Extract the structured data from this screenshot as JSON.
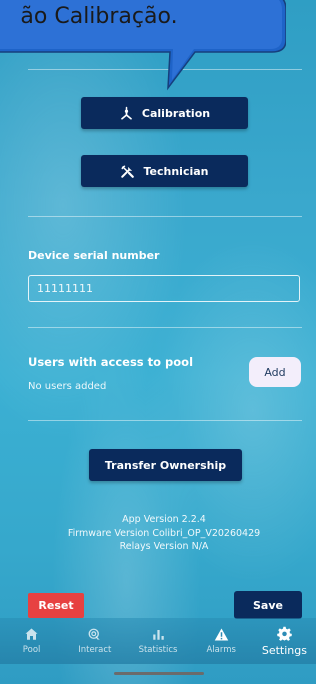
{
  "callout": {
    "text": "ão Calibração."
  },
  "buttons": {
    "calibration": "Calibration",
    "technician": "Technician"
  },
  "serial": {
    "label": "Device serial number",
    "value": "11111111"
  },
  "users": {
    "title": "Users with access to pool",
    "empty": "No users added",
    "add": "Add"
  },
  "transfer": {
    "label": "Transfer Ownership"
  },
  "versions": {
    "app": "App Version 2.2.4",
    "firmware": "Firmware Version Colibri_OP_V20260429",
    "relays": "Relays Version N/A"
  },
  "actions": {
    "reset": "Reset",
    "save": "Save"
  },
  "tabs": [
    {
      "label": "Pool",
      "icon": "home-icon"
    },
    {
      "label": "Interact",
      "icon": "interact-icon"
    },
    {
      "label": "Statistics",
      "icon": "statistics-icon"
    },
    {
      "label": "Alarms",
      "icon": "alarm-icon"
    },
    {
      "label": "Settings",
      "icon": "gear-icon",
      "active": true
    }
  ],
  "colors": {
    "navy": "#0a2a5c",
    "reset_red": "#e74141",
    "callout_fill": "#1e63c8",
    "callout_border": "#163f7c"
  }
}
